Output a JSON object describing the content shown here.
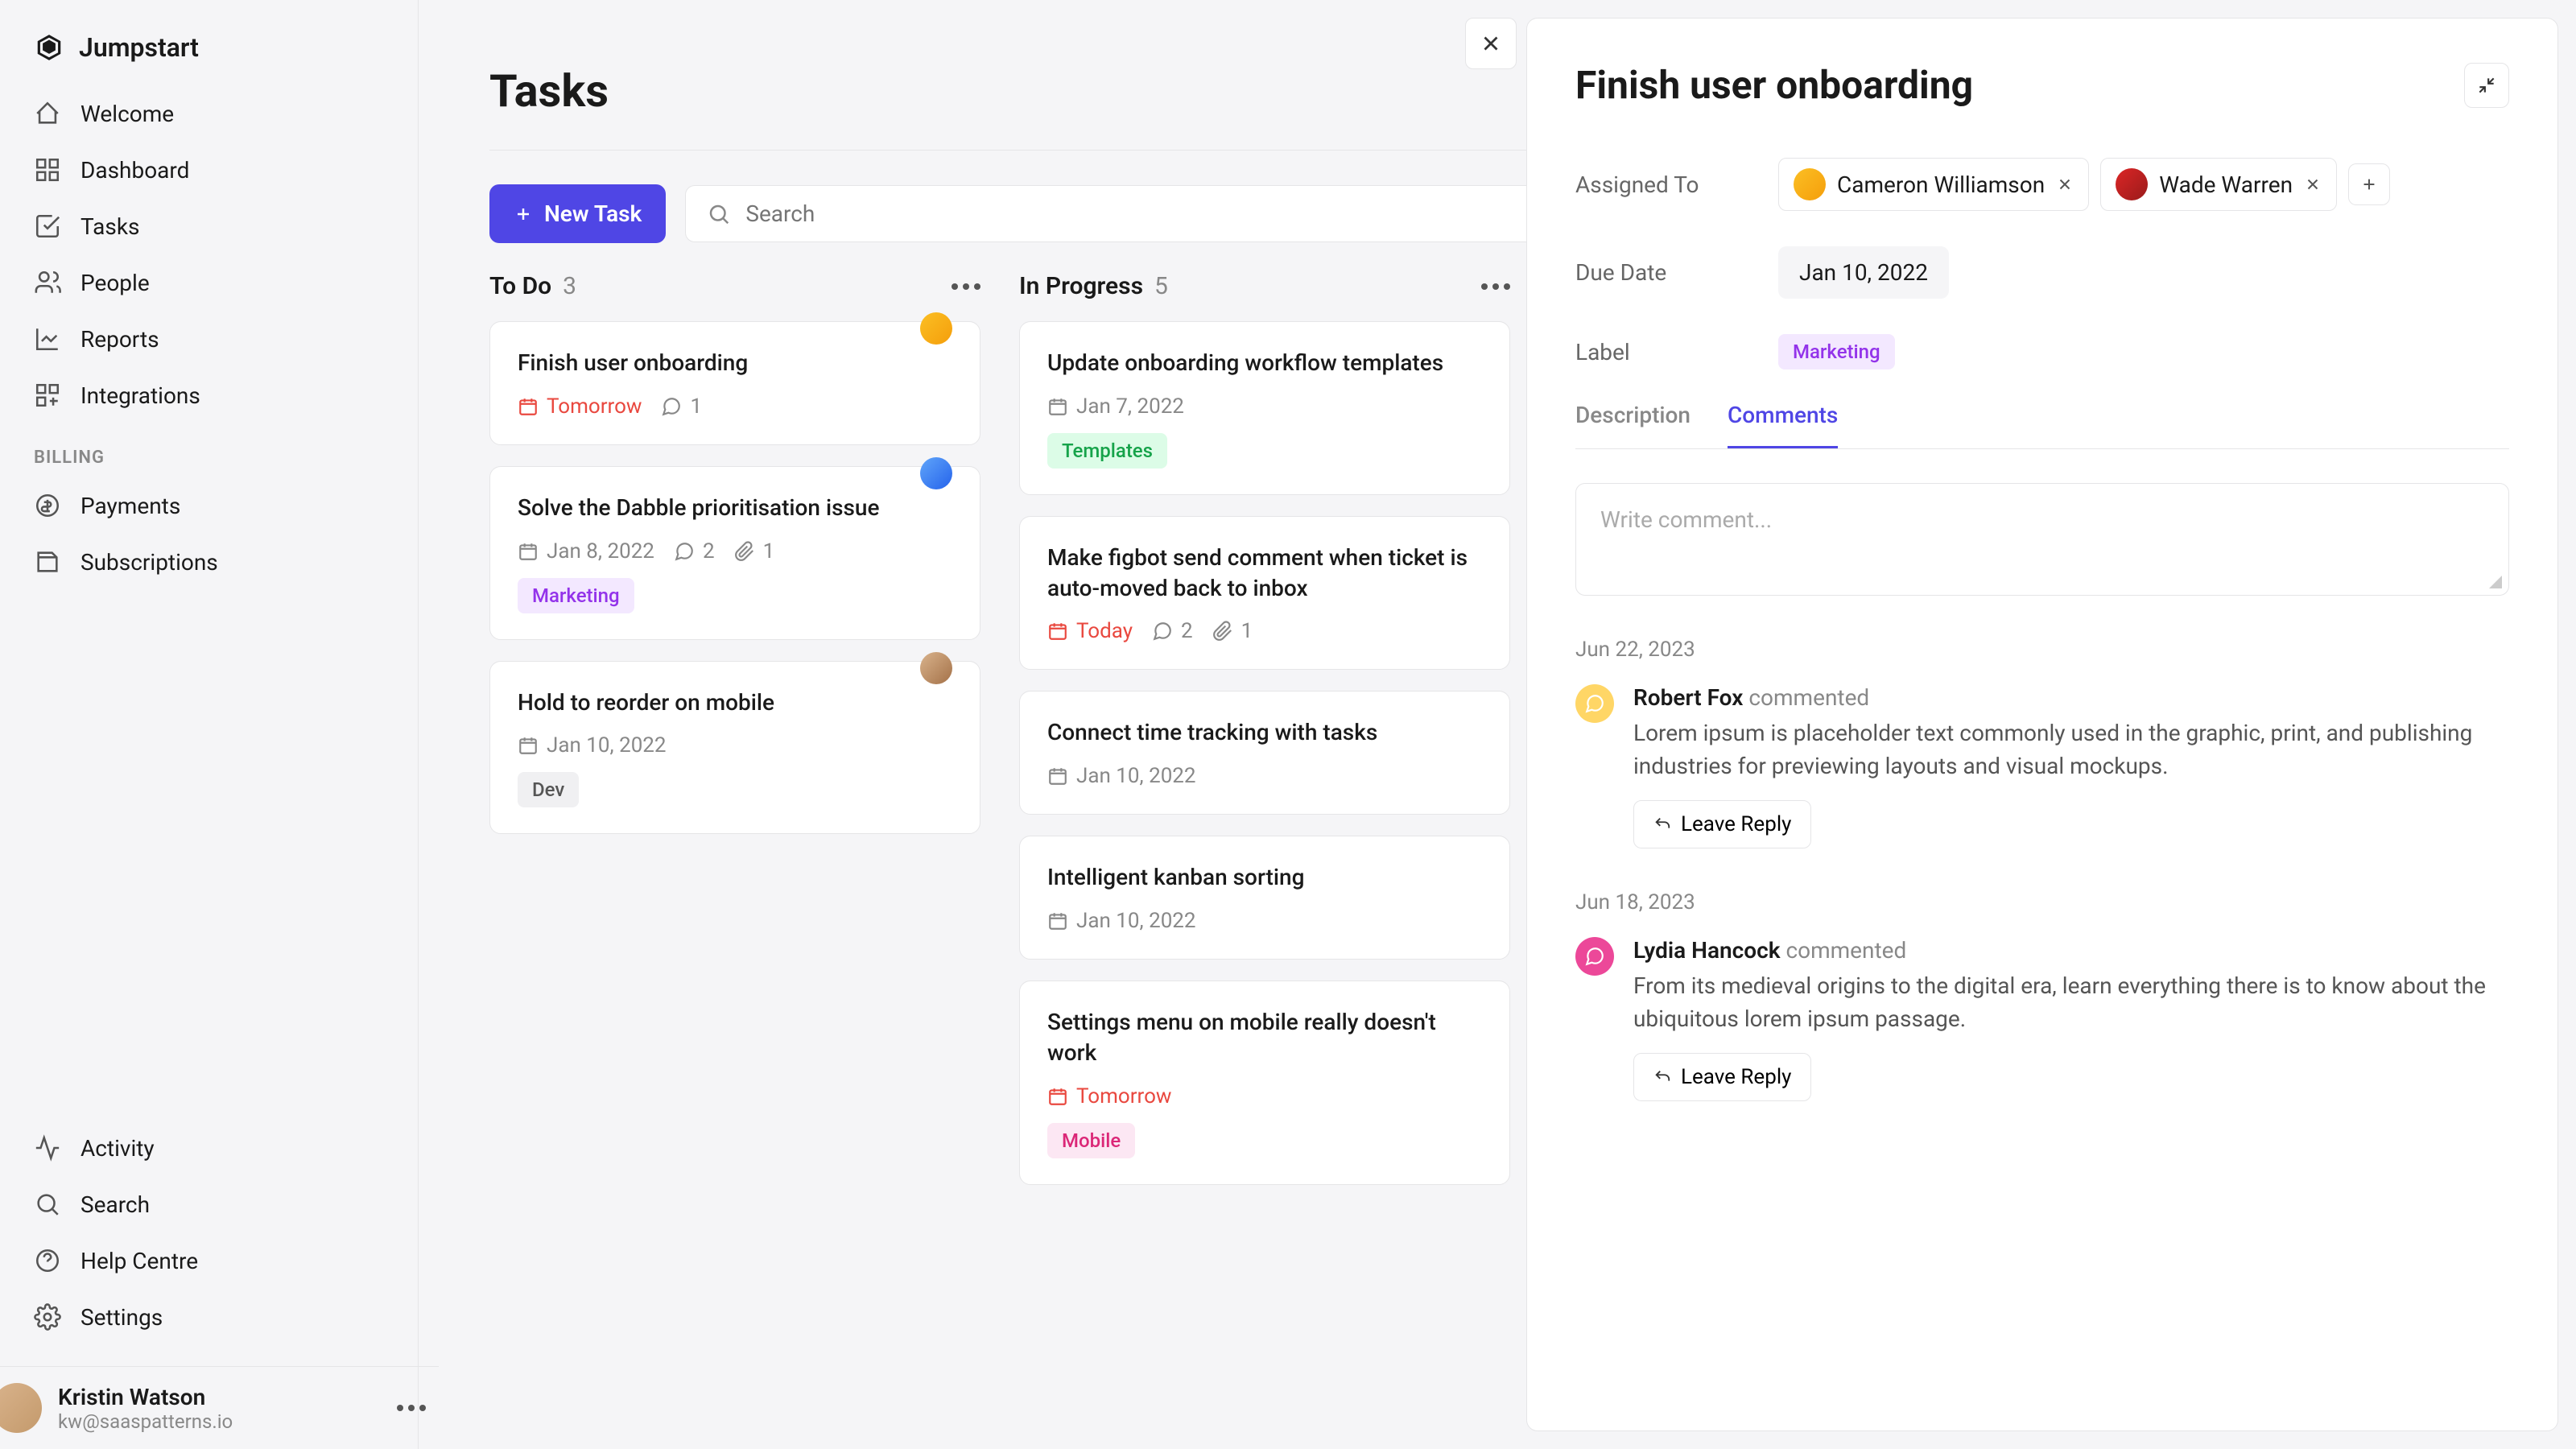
{
  "brand": "Jumpstart",
  "nav": {
    "main": [
      "Welcome",
      "Dashboard",
      "Tasks",
      "People",
      "Reports",
      "Integrations"
    ],
    "billing_label": "BILLING",
    "billing": [
      "Payments",
      "Subscriptions"
    ],
    "footer": [
      "Activity",
      "Search",
      "Help Centre",
      "Settings"
    ]
  },
  "user": {
    "name": "Kristin Watson",
    "email": "kw@saaspatterns.io"
  },
  "page_title": "Tasks",
  "toolbar": {
    "new_task": "New Task",
    "search_placeholder": "Search"
  },
  "columns": [
    {
      "title": "To Do",
      "count": "3",
      "cards": [
        {
          "title": "Finish user onboarding",
          "date": "Tomorrow",
          "date_red": true,
          "comments": "1",
          "attachments": null,
          "tag": null,
          "avatar": "av1"
        },
        {
          "title": "Solve the Dabble prioritisation issue",
          "date": "Jan 8, 2022",
          "date_red": false,
          "comments": "2",
          "attachments": "1",
          "tag": "Marketing",
          "tag_class": "tag-marketing",
          "avatar": "av2"
        },
        {
          "title": "Hold to reorder on mobile",
          "date": "Jan 10, 2022",
          "date_red": false,
          "comments": null,
          "attachments": null,
          "tag": "Dev",
          "tag_class": "tag-dev",
          "avatar": "av3"
        }
      ]
    },
    {
      "title": "In Progress",
      "count": "5",
      "cards": [
        {
          "title": "Update onboarding workflow templates",
          "date": "Jan 7, 2022",
          "date_red": false,
          "comments": null,
          "attachments": null,
          "tag": "Templates",
          "tag_class": "tag-templates",
          "avatar": null
        },
        {
          "title": "Make figbot send comment when ticket is auto-moved back to inbox",
          "date": "Today",
          "date_red": true,
          "comments": "2",
          "attachments": "1",
          "tag": null,
          "avatar": null
        },
        {
          "title": "Connect time tracking with tasks",
          "date": "Jan 10, 2022",
          "date_red": false,
          "comments": null,
          "attachments": null,
          "tag": null,
          "avatar": null
        },
        {
          "title": "Intelligent kanban sorting",
          "date": "Jan 10, 2022",
          "date_red": false,
          "comments": null,
          "attachments": null,
          "tag": null,
          "avatar": null
        },
        {
          "title": "Settings menu on mobile really doesn't work",
          "date": "Tomorrow",
          "date_red": true,
          "comments": null,
          "attachments": null,
          "tag": "Mobile",
          "tag_class": "tag-mobile",
          "avatar": null
        }
      ]
    }
  ],
  "detail": {
    "title": "Finish user onboarding",
    "assigned_label": "Assigned To",
    "assignees": [
      {
        "name": "Cameron Williamson",
        "color": "linear-gradient(135deg,#fbbf24,#f59e0b)"
      },
      {
        "name": "Wade Warren",
        "color": "linear-gradient(135deg,#dc2626,#991b1b)"
      }
    ],
    "due_label": "Due Date",
    "due_value": "Jan 10, 2022",
    "label_label": "Label",
    "label_value": "Marketing",
    "tab_description": "Description",
    "tab_comments": "Comments",
    "comment_placeholder": "Write comment...",
    "reply_label": "Leave Reply",
    "comments": [
      {
        "date": "Jun 22, 2023",
        "author": "Robert Fox",
        "action": "commented",
        "icon": "y",
        "msg": "Lorem ipsum is placeholder text commonly used in the graphic, print, and publishing industries for previewing layouts and visual mockups."
      },
      {
        "date": "Jun 18, 2023",
        "author": "Lydia Hancock",
        "action": "commented",
        "icon": "p",
        "msg": "From its medieval origins to the digital era, learn everything there is to know about the ubiquitous lorem ipsum passage."
      }
    ]
  }
}
